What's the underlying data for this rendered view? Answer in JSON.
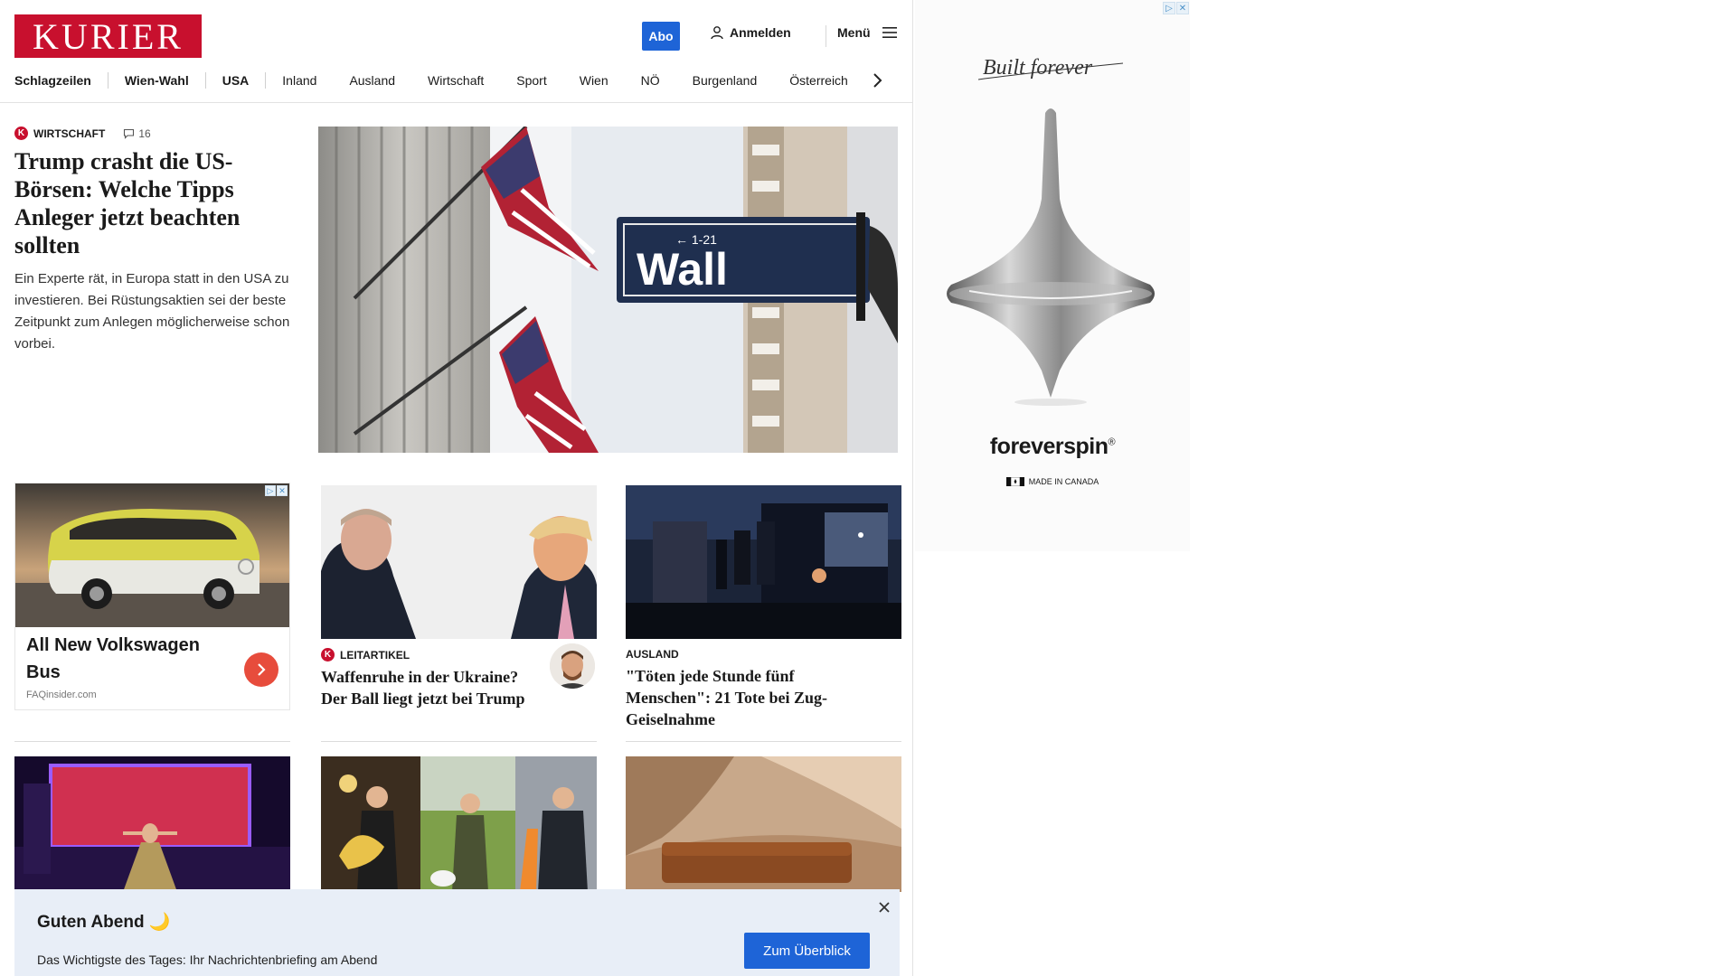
{
  "header": {
    "logo": "KURIER",
    "abo_label": "Abo",
    "login_label": "Anmelden",
    "menu_label": "Menü"
  },
  "nav": {
    "items": [
      "Schlagzeilen",
      "Wien-Wahl",
      "USA",
      "Inland",
      "Ausland",
      "Wirtschaft",
      "Sport",
      "Wien",
      "NÖ",
      "Burgenland",
      "Österreich"
    ]
  },
  "top_story": {
    "kicker": "Wirtschaft",
    "comments": "16",
    "title": "Trump crasht die US-Börsen: Welche Tipps Anleger jetzt beachten sollten",
    "teaser": "Ein Experte rät, in Europa statt in den USA zu investieren. Bei Rüstungsaktien sei der beste Zeitpunkt zum Anlegen möglicherweise schon vorbei.",
    "image_sign": "Wall",
    "image_sign_small": "← 1-21"
  },
  "ad_card": {
    "title": "All New Volkswagen Bus",
    "source": "FAQinsider.com"
  },
  "cards": [
    {
      "kicker": "Leitartikel",
      "title": "Waffenruhe in der Ukraine? Der Ball liegt jetzt bei Trump"
    },
    {
      "kicker": "Ausland",
      "title": "\"Töten jede Stunde fünf Menschen\": 21 Tote bei Zug-Geiselnahme"
    }
  ],
  "banner": {
    "greeting": "Guten Abend 🌙",
    "subtitle": "Das Wichtigste des Tages: Ihr Nachrichtenbriefing am Abend",
    "cta": "Zum Überblick"
  },
  "side_ad": {
    "script": "Built forever",
    "brand": "foreverspin",
    "registered": "®",
    "made_in": "MADE IN CANADA"
  },
  "colors": {
    "brand_red": "#c8102e",
    "accent_blue": "#1e64d7",
    "banner_bg": "#e8eef7"
  }
}
